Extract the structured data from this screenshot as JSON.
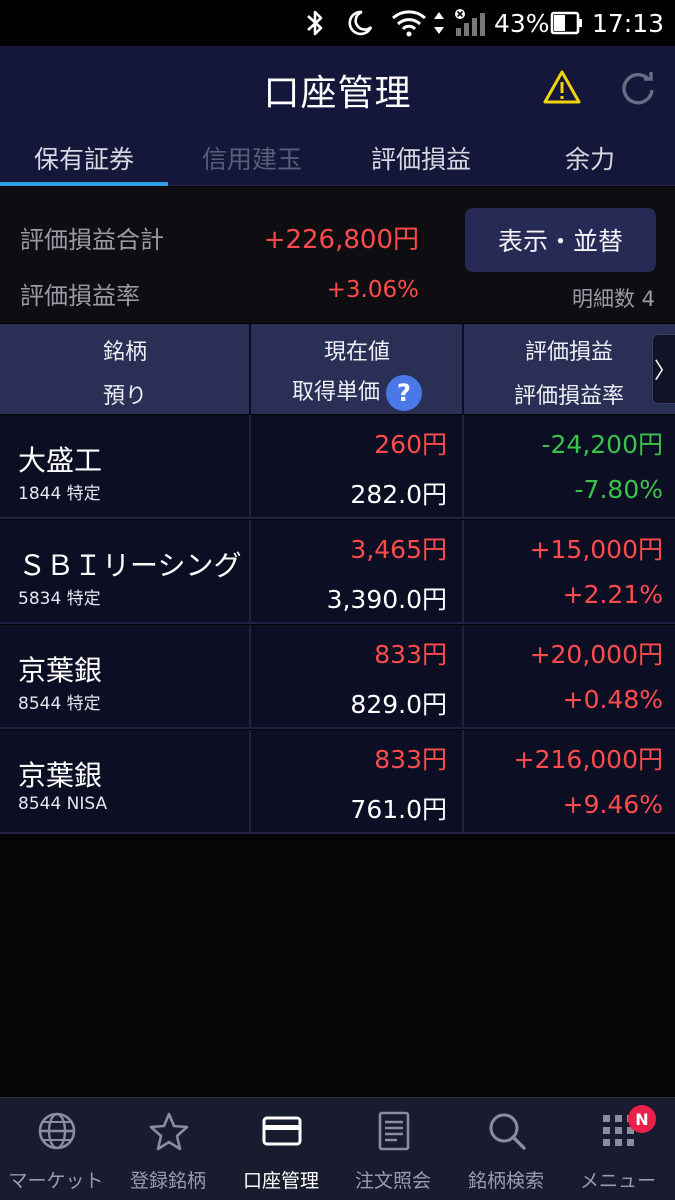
{
  "status_bar": {
    "battery": "43%",
    "time": "17:13",
    "icons": [
      "bluetooth-icon",
      "moon-icon",
      "wifi-icon",
      "signal-icon",
      "battery-icon"
    ]
  },
  "header": {
    "title": "口座管理",
    "warning_icon": "warning-icon",
    "refresh_icon": "refresh-icon"
  },
  "tabs": [
    {
      "label": "保有証券",
      "active": true
    },
    {
      "label": "信用建玉",
      "disabled": true
    },
    {
      "label": "評価損益"
    },
    {
      "label": "余力"
    }
  ],
  "summary": {
    "pl_total_label": "評価損益合計",
    "pl_total_value": "+226,800円",
    "pl_rate_label": "評価損益率",
    "pl_rate_value": "+3.06%",
    "sort_button": "表示・並替",
    "count_text": "明細数 4"
  },
  "table": {
    "headers": {
      "col1_top": "銘柄",
      "col1_bottom": "預り",
      "col2_top": "現在値",
      "col2_bottom": "取得単価",
      "col3_top": "評価損益",
      "col3_bottom": "評価損益率",
      "more": "〉"
    },
    "rows": [
      {
        "name": "大盛工",
        "code": "1844 特定",
        "price": "260円",
        "cost": "282.0円",
        "pl": "-24,200円",
        "rate": "-7.80%",
        "trend": "neg"
      },
      {
        "name": "ＳＢＩリーシング",
        "code": "5834 特定",
        "price": "3,465円",
        "cost": "3,390.0円",
        "pl": "+15,000円",
        "rate": "+2.21%",
        "trend": "pos"
      },
      {
        "name": "京葉銀",
        "code": "8544 特定",
        "price": "833円",
        "cost": "829.0円",
        "pl": "+20,000円",
        "rate": "+0.48%",
        "trend": "pos"
      },
      {
        "name": "京葉銀",
        "code": "8544 NISA",
        "price": "833円",
        "cost": "761.0円",
        "pl": "+216,000円",
        "rate": "+9.46%",
        "trend": "pos"
      }
    ]
  },
  "bottom_nav": [
    {
      "label": "マーケット",
      "icon": "globe-icon"
    },
    {
      "label": "登録銘柄",
      "icon": "star-icon"
    },
    {
      "label": "口座管理",
      "icon": "card-icon",
      "active": true
    },
    {
      "label": "注文照会",
      "icon": "document-icon"
    },
    {
      "label": "銘柄検索",
      "icon": "search-icon"
    },
    {
      "label": "メニュー",
      "icon": "grid-icon",
      "badge": "N"
    }
  ],
  "colors": {
    "positive": "#ff4b4b",
    "negative": "#3cc24a",
    "header_bg": "#15173a",
    "tab_underline": "#2ea0e6",
    "help_icon": "#4a78e8",
    "badge": "#e8204a"
  }
}
